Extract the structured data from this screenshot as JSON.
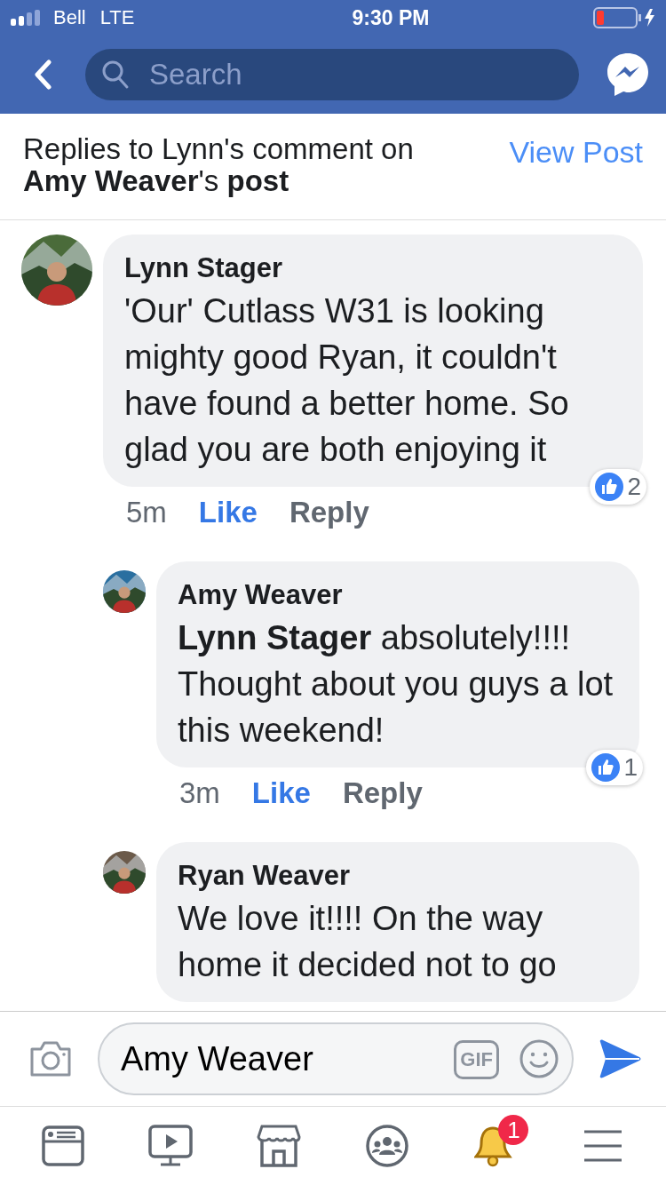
{
  "status_bar": {
    "carrier": "Bell",
    "network": "LTE",
    "time": "9:30 PM"
  },
  "nav": {
    "search": {
      "placeholder": "Search"
    }
  },
  "header": {
    "title": "Replies to Lynn's comment on **Amy Weaver**'s **post**",
    "link": "View Post"
  },
  "comments": [
    {
      "kind": "comment",
      "author": "Lynn Stager",
      "text": "'Our' Cutlass W31 is looking mighty good Ryan, it couldn't have found a better home. So glad you are both enjoying it",
      "time": "5m",
      "like": "Like",
      "liked": true,
      "reply": "Reply",
      "reactions": "2"
    },
    {
      "kind": "reply",
      "author": "Amy Weaver",
      "text": "**Lynn Stager** absolutely!!!! Thought about you guys a lot this weekend!",
      "time": "3m",
      "like": "Like",
      "liked": true,
      "reply": "Reply",
      "reactions": "1"
    },
    {
      "kind": "reply",
      "author": "Ryan Weaver",
      "text": "We love it!!!! On the way home it decided not to go"
    }
  ],
  "composer": {
    "value": "Amy Weaver",
    "gif": "GIF"
  },
  "tabs": [
    {
      "kind": "news",
      "selected": false
    },
    {
      "kind": "video",
      "selected": false
    },
    {
      "kind": "market",
      "selected": false
    },
    {
      "kind": "groups",
      "selected": false
    },
    {
      "kind": "bell",
      "selected": true,
      "badge": "1"
    },
    {
      "kind": "menu",
      "selected": false
    }
  ]
}
